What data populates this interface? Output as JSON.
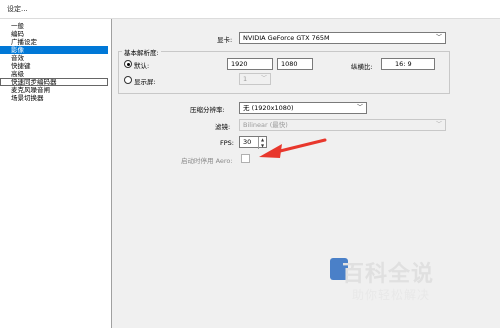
{
  "window": {
    "title": "设定..."
  },
  "nav": {
    "items": [
      {
        "label": "一般",
        "selected": false
      },
      {
        "label": "编码",
        "selected": false
      },
      {
        "label": "广播设定",
        "selected": false
      },
      {
        "label": "影像",
        "selected": true
      },
      {
        "label": "音效",
        "selected": false
      },
      {
        "label": "快捷键",
        "selected": false
      },
      {
        "label": "高级",
        "selected": false
      },
      {
        "label": "快速同步编码器",
        "selected": false,
        "boxed": true
      },
      {
        "label": "麦克风噪音闸",
        "selected": false
      },
      {
        "label": "场景切换器",
        "selected": false
      }
    ]
  },
  "video": {
    "adapter_label": "显卡:",
    "adapter_value": "NVIDIA GeForce GTX 765M",
    "base_res_label": "基本解析度:",
    "default_label": "默认:",
    "width": "1920",
    "height": "1080",
    "aspect_label": "纵横比:",
    "aspect_value": "16: 9",
    "monitor_label": "显示屏:",
    "monitor_value": "1",
    "downscale_label": "压缩分辨率:",
    "downscale_value": "无 (1920x1080)",
    "filter_label": "滤镜:",
    "filter_value": "Bilinear (最快)",
    "fps_label": "FPS:",
    "fps_value": "30",
    "aero_label": "启动时停用 Aero:"
  },
  "watermark": {
    "title": "百科全说",
    "subtitle": "助你轻松解决"
  },
  "colors": {
    "selection": "#0078d7",
    "arrow": "#e8372c"
  }
}
